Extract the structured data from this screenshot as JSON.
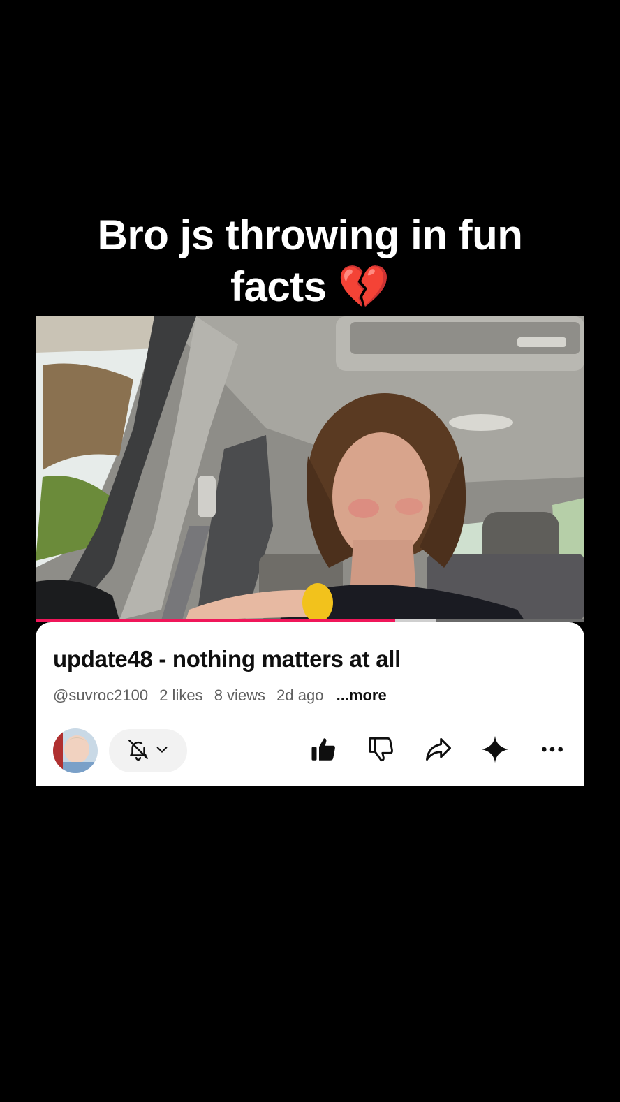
{
  "caption": {
    "line1": "Bro js throwing in fun",
    "line2": "facts 💔"
  },
  "video": {
    "title": "update48 - nothing matters at all",
    "progress_played": 0.655,
    "progress_buffered": 0.73
  },
  "meta": {
    "channel": "@suvroc2100",
    "likes": "2 likes",
    "views": "8 views",
    "age": "2d ago",
    "more_label": "...more"
  },
  "icons": {
    "subscribe": "bell-off-icon",
    "dropdown": "chevron-down-icon",
    "like": "thumbs-up-filled-icon",
    "dislike": "thumbs-down-icon",
    "share": "share-icon",
    "ai": "sparkle-icon",
    "more": "more-dots-icon"
  },
  "colors": {
    "progress_played": "#f0165a",
    "card_bg": "#ffffff",
    "text_primary": "#0f0f0f",
    "text_secondary": "#606060"
  }
}
